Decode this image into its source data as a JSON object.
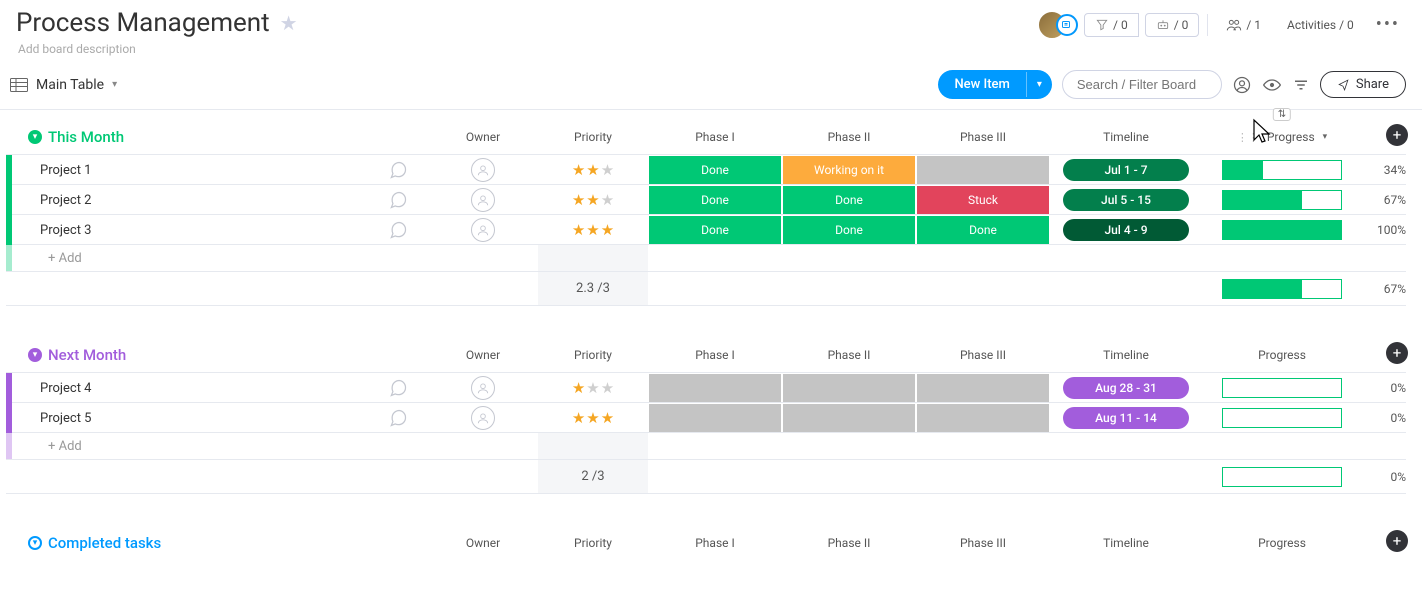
{
  "header": {
    "title": "Process Management",
    "description": "Add board description",
    "automations_count": "/ 0",
    "integrations_count": "/ 0",
    "people_count": "/ 1",
    "activities_label": "Activities / 0"
  },
  "toolbar": {
    "view_name": "Main Table",
    "new_item_label": "New Item",
    "search_placeholder": "Search / Filter Board",
    "share_label": "Share"
  },
  "columns": {
    "owner": "Owner",
    "priority": "Priority",
    "phase1": "Phase I",
    "phase2": "Phase II",
    "phase3": "Phase III",
    "timeline": "Timeline",
    "progress": "Progress"
  },
  "groups": [
    {
      "title": "This Month",
      "color": "#00c875",
      "toggle_solid": true,
      "add_label": "+ Add",
      "rows": [
        {
          "name": "Project 1",
          "priority": 2,
          "phase1": {
            "label": "Done",
            "status": "done"
          },
          "phase2": {
            "label": "Working on it",
            "status": "working"
          },
          "phase3": {
            "label": "",
            "status": "empty"
          },
          "timeline": {
            "label": "Jul 1 - 7",
            "style": "green-dark"
          },
          "progress": 34
        },
        {
          "name": "Project 2",
          "priority": 2,
          "phase1": {
            "label": "Done",
            "status": "done"
          },
          "phase2": {
            "label": "Done",
            "status": "done"
          },
          "phase3": {
            "label": "Stuck",
            "status": "stuck"
          },
          "timeline": {
            "label": "Jul 5 - 15",
            "style": "green-dark"
          },
          "progress": 67
        },
        {
          "name": "Project 3",
          "priority": 3,
          "phase1": {
            "label": "Done",
            "status": "done"
          },
          "phase2": {
            "label": "Done",
            "status": "done"
          },
          "phase3": {
            "label": "Done",
            "status": "done"
          },
          "timeline": {
            "label": "Jul 4 - 9",
            "style": "green-darker"
          },
          "progress": 100
        }
      ],
      "footer": {
        "priority_avg": "2.3 /3",
        "progress": 67,
        "pct": "67%"
      }
    },
    {
      "title": "Next Month",
      "color": "#a25ddc",
      "toggle_solid": true,
      "add_label": "+ Add",
      "rows": [
        {
          "name": "Project 4",
          "priority": 1,
          "phase1": {
            "label": "",
            "status": "empty"
          },
          "phase2": {
            "label": "",
            "status": "empty"
          },
          "phase3": {
            "label": "",
            "status": "empty"
          },
          "timeline": {
            "label": "Aug 28 - 31",
            "style": "purple"
          },
          "progress": 0
        },
        {
          "name": "Project 5",
          "priority": 3,
          "phase1": {
            "label": "",
            "status": "empty"
          },
          "phase2": {
            "label": "",
            "status": "empty"
          },
          "phase3": {
            "label": "",
            "status": "empty"
          },
          "timeline": {
            "label": "Aug 11 - 14",
            "style": "purple"
          },
          "progress": 0
        }
      ],
      "footer": {
        "priority_avg": "2 /3",
        "progress": 0,
        "pct": "0%"
      }
    },
    {
      "title": "Completed tasks",
      "color": "#009aff",
      "toggle_solid": false,
      "rows": [],
      "footer": null,
      "add_label": ""
    }
  ]
}
